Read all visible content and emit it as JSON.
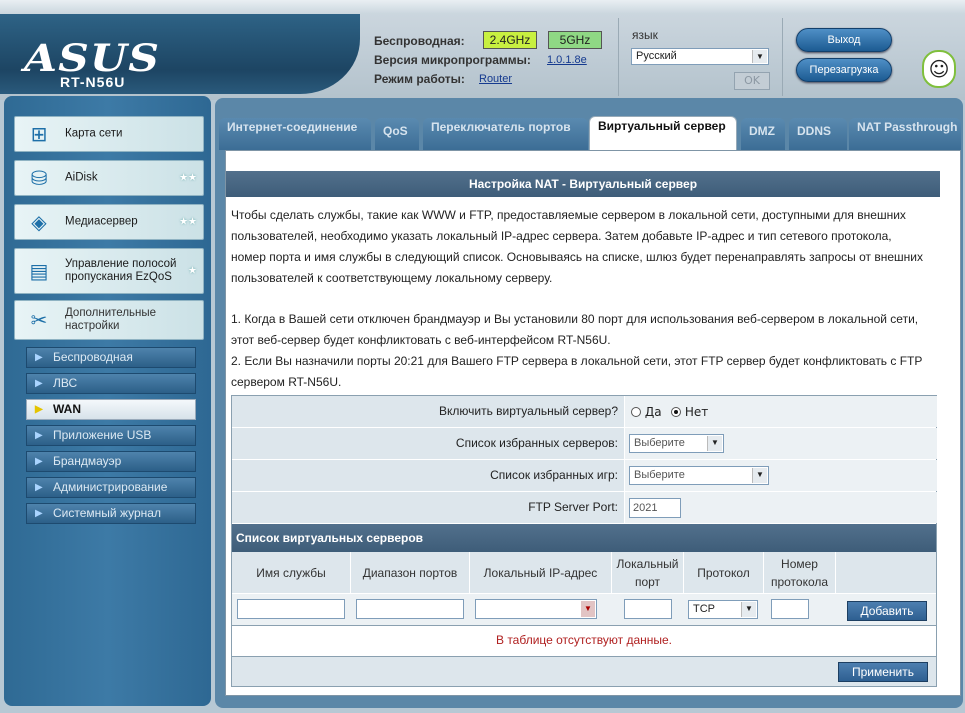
{
  "brand": {
    "logo": "ASUS",
    "model": "RT-N56U"
  },
  "status": {
    "wireless_label": "Беспроводная:",
    "freq_24": "2.4GHz",
    "freq_5": "5GHz",
    "firmware_label": "Версия микропрограммы:",
    "firmware_value": "1.0.1.8e",
    "mode_label": "Режим работы:",
    "mode_value": "Router"
  },
  "language": {
    "label": "язык",
    "selected": "Русский",
    "ok": "OK"
  },
  "header_buttons": {
    "logout": "Выход",
    "reboot": "Перезагрузка"
  },
  "sidebar": {
    "main": [
      {
        "label": "Карта сети",
        "icon": "network-map-icon"
      },
      {
        "label": "AiDisk",
        "icon": "disk-icon"
      },
      {
        "label": "Медиасервер",
        "icon": "media-server-icon"
      },
      {
        "label": "Управление полосой пропускания EzQoS",
        "icon": "qos-icon"
      },
      {
        "label": "Дополнительные настройки",
        "icon": "tools-icon"
      }
    ],
    "sub": [
      {
        "label": "Беспроводная"
      },
      {
        "label": "ЛВС"
      },
      {
        "label": "WAN"
      },
      {
        "label": "Приложение USB"
      },
      {
        "label": "Брандмауэр"
      },
      {
        "label": "Администрирование"
      },
      {
        "label": "Системный журнал"
      }
    ]
  },
  "tabs": [
    {
      "label": "Интернет-соединение"
    },
    {
      "label": "QoS"
    },
    {
      "label": "Переключатель портов"
    },
    {
      "label": "Виртуальный сервер"
    },
    {
      "label": "DMZ"
    },
    {
      "label": "DDNS"
    },
    {
      "label": "NAT Passthrough"
    }
  ],
  "panel": {
    "title": "Настройка NAT - Виртуальный сервер",
    "desc1": "Чтобы сделать службы, такие как WWW и FTP, предоставляемые сервером в локальной сети, доступными для внешних",
    "desc2": "пользователей, необходимо указать локальный IP-адрес сервера. Затем добавьте IP-адрес и тип сетевого протокола,",
    "desc3": "номер порта и имя службы в следующий список. Основываясь на списке, шлюз будет перенаправлять запросы от внешних",
    "desc4": "пользователей к соответствующему локальному серверу.",
    "note1a": "1. Когда в Вашей сети отключен брандмауэр и Вы установили 80 порт для использования веб-сервером в локальной сети,",
    "note1b": "этот веб-сервер будет конфликтовать с веб-интерфейсом RT-N56U.",
    "note2a": "2. Если Вы назначили порты 20:21 для Вашего FTP сервера в локальной сети, этот FTP сервер будет конфликтовать с FTP",
    "note2b": "сервером RT-N56U."
  },
  "form": {
    "enable_label": "Включить виртуальный сервер?",
    "yes": "Да",
    "no": "Нет",
    "enable_value": "no",
    "servers_label": "Список избранных серверов:",
    "servers_value": "Выберите",
    "games_label": "Список избранных игр:",
    "games_value": "Выберите",
    "ftp_label": "FTP Server Port:",
    "ftp_value": "2021"
  },
  "vs_table": {
    "title": "Список виртуальных серверов",
    "headers": [
      "Имя службы",
      "Диапазон портов",
      "Локальный IP-адрес",
      "Локальный порт",
      "Протокол",
      "Номер протокола"
    ],
    "protocol_value": "TCP",
    "add_button": "Добавить",
    "empty_message": "В таблице отсутствуют данные.",
    "apply_button": "Применить"
  }
}
